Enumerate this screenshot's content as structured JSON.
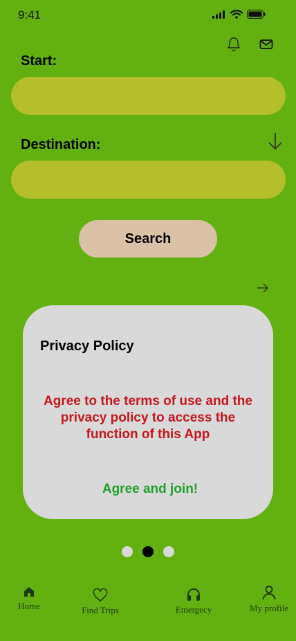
{
  "status_bar": {
    "time": "9:41"
  },
  "form": {
    "start_label": "Start:",
    "start_value": "",
    "destination_label": "Destination:",
    "destination_value": "",
    "search_label": "Search"
  },
  "card": {
    "title": "Privacy Policy",
    "message": "Agree to the terms of use and the privacy policy to access the function of this App",
    "cta": "Agree and join!"
  },
  "pager": {
    "count": 3,
    "active_index": 1
  },
  "nav": {
    "items": [
      {
        "label": "Home",
        "icon": "home-icon"
      },
      {
        "label": "Find Trips",
        "icon": "heart-icon"
      },
      {
        "label": "Emergecy",
        "icon": "headphones-icon"
      },
      {
        "label": "My profile",
        "icon": "user-icon"
      }
    ]
  },
  "colors": {
    "background": "#62b111",
    "field": "#b5bf2c",
    "button": "#d9c2a5",
    "card": "#d9d9d9",
    "warning": "#c3171f",
    "cta": "#1fa02a"
  }
}
